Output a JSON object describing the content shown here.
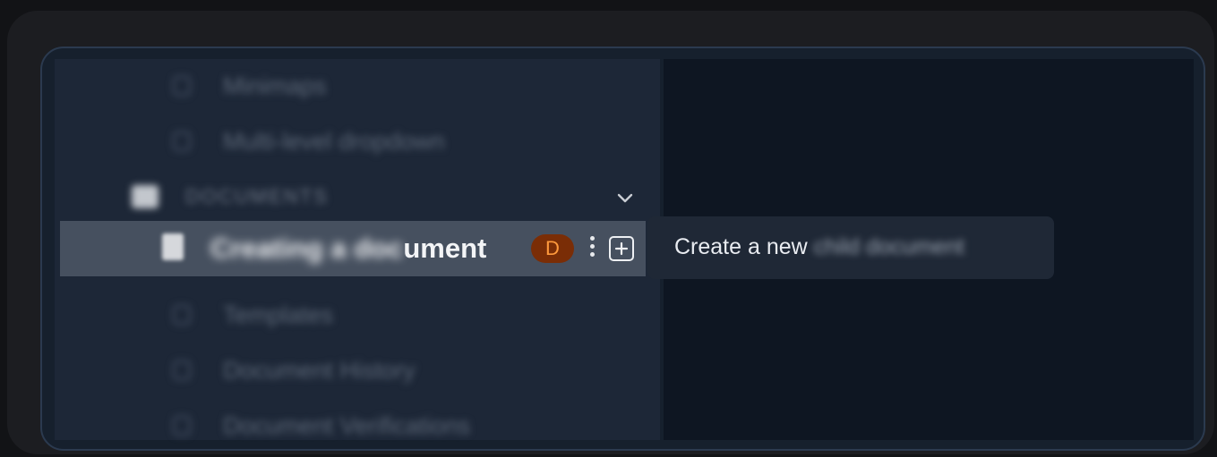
{
  "sidebar": {
    "items_above": [
      {
        "label": "Minimaps",
        "icon": "page-icon"
      },
      {
        "label": "Multi-level dropdown",
        "icon": "page-icon"
      }
    ],
    "section": {
      "label": "DOCUMENTS",
      "icon": "folder-icon",
      "toggle_icon": "chevron-down-icon"
    },
    "active_item": {
      "title_blurred": "Creating a doc",
      "title_clear": "ument",
      "icon": "document-icon",
      "avatar_initial": "D",
      "more_icon": "kebab-icon",
      "add_icon": "plus-square-icon",
      "highlight_color": "#46505f"
    },
    "items_below": [
      {
        "label": "Templates",
        "icon": "page-icon"
      },
      {
        "label": "Document History",
        "icon": "page-icon"
      },
      {
        "label": "Document Verifications",
        "icon": "page-icon"
      }
    ]
  },
  "tooltip": {
    "text_clear": "Create a new",
    "text_blurred": "child document"
  },
  "colors": {
    "avatar_bg": "#7a2d06",
    "avatar_fg": "#ff9a3d",
    "sidebar_bg": "#1d2737",
    "content_bg": "#0e1622"
  }
}
